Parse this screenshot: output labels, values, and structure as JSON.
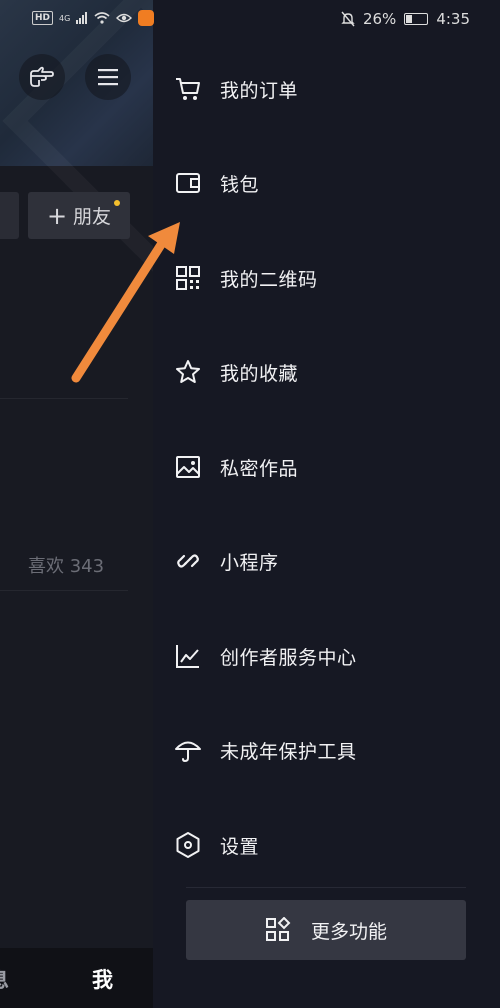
{
  "status_bar": {
    "left": {
      "hd": "HD",
      "net": "4G"
    },
    "battery": "26%",
    "time": "4:35"
  },
  "background_page": {
    "add_friend": "朋友",
    "likes": "喜欢 343",
    "bottom_nav": {
      "messages": "息",
      "me": "我"
    }
  },
  "drawer": {
    "items": [
      {
        "label": "我的订单",
        "icon": "cart-icon"
      },
      {
        "label": "钱包",
        "icon": "wallet-icon"
      },
      {
        "label": "我的二维码",
        "icon": "qr-code-icon"
      },
      {
        "label": "我的收藏",
        "icon": "star-icon"
      },
      {
        "label": "私密作品",
        "icon": "image-icon"
      },
      {
        "label": "小程序",
        "icon": "link-icon"
      },
      {
        "label": "创作者服务中心",
        "icon": "chart-icon"
      },
      {
        "label": "未成年保护工具",
        "icon": "umbrella-icon"
      },
      {
        "label": "设置",
        "icon": "settings-hexagon-icon"
      }
    ],
    "more_button": "更多功能"
  },
  "annotation": {
    "color": "#f08a3c"
  }
}
